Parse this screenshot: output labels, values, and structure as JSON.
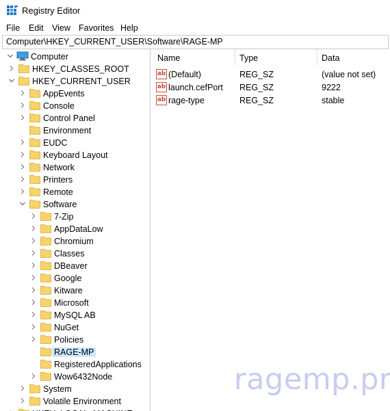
{
  "window": {
    "title": "Registry Editor"
  },
  "menu": [
    "File",
    "Edit",
    "View",
    "Favorites",
    "Help"
  ],
  "address": "Computer\\HKEY_CURRENT_USER\\Software\\RAGE-MP",
  "tree": {
    "root": "Computer",
    "hives": [
      "HKEY_CLASSES_ROOT",
      "HKEY_CURRENT_USER"
    ],
    "hkcu_children": [
      "AppEvents",
      "Console",
      "Control Panel",
      "Environment",
      "EUDC",
      "Keyboard Layout",
      "Network",
      "Printers",
      "Remote",
      "Software"
    ],
    "software_children": [
      "7-Zip",
      "AppDataLow",
      "Chromium",
      "Classes",
      "DBeaver",
      "Google",
      "Kitware",
      "Microsoft",
      "MySQL AB",
      "NuGet",
      "Policies",
      "RAGE-MP",
      "RegisteredApplications",
      "Wow6432Node"
    ],
    "after_software": [
      "System",
      "Volatile Environment"
    ],
    "partial": "HKEY_LOCAL_MACHINE"
  },
  "list": {
    "columns": [
      "Name",
      "Type",
      "Data"
    ],
    "rows": [
      {
        "name": "(Default)",
        "type": "REG_SZ",
        "data": "(value not set)"
      },
      {
        "name": "launch.cefPort",
        "type": "REG_SZ",
        "data": "9222"
      },
      {
        "name": "rage-type",
        "type": "REG_SZ",
        "data": "stable"
      }
    ],
    "icon_text": "ab"
  },
  "watermark": "ragemp.pro",
  "colors": {
    "selection": "#cce8ff",
    "folder": "#f2c94c",
    "value_icon": "#c84b3c"
  }
}
